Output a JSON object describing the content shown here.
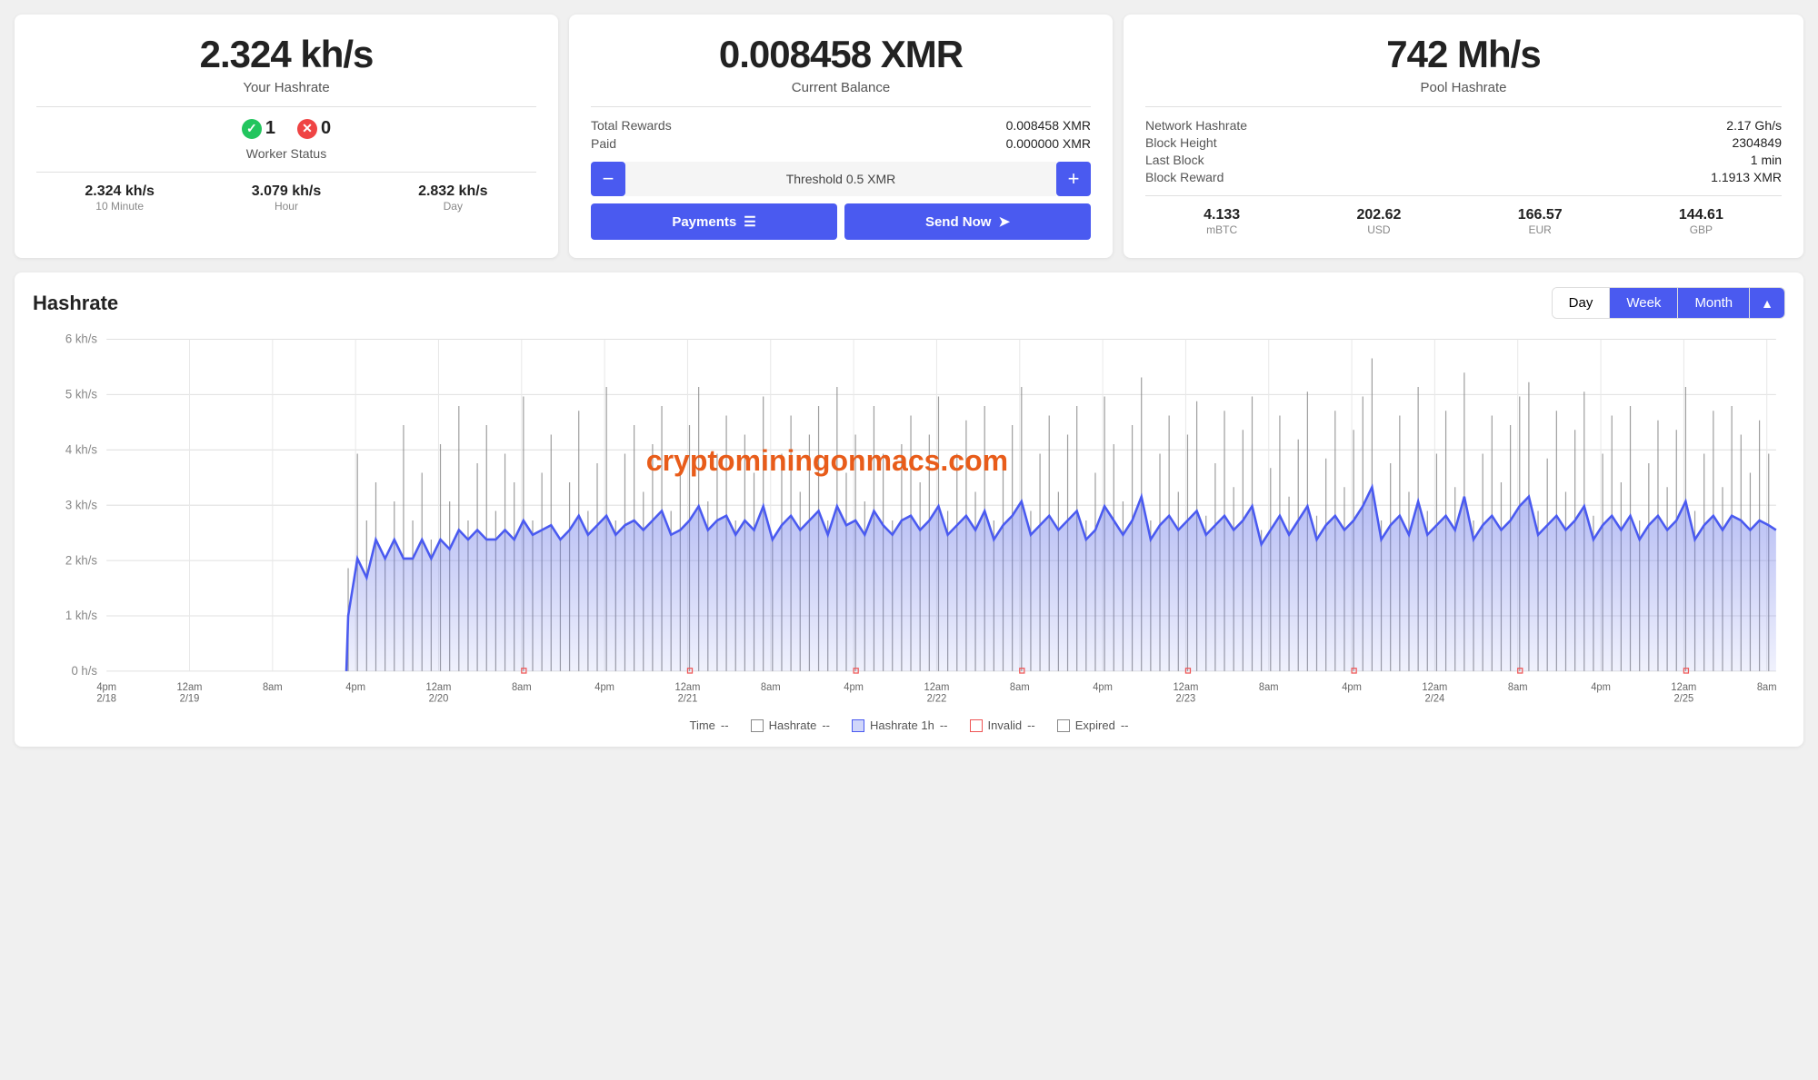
{
  "hashrate_panel": {
    "big_value": "2.324 kh/s",
    "label": "Your Hashrate",
    "worker_online": "1",
    "worker_offline": "0",
    "worker_label": "Worker Status",
    "stat_10min_val": "2.324 kh/s",
    "stat_10min_label": "10 Minute",
    "stat_hour_val": "3.079 kh/s",
    "stat_hour_label": "Hour",
    "stat_day_val": "2.832 kh/s",
    "stat_day_label": "Day"
  },
  "balance_panel": {
    "big_value": "0.008458 XMR",
    "label": "Current Balance",
    "total_rewards_label": "Total Rewards",
    "total_rewards_value": "0.008458 XMR",
    "paid_label": "Paid",
    "paid_value": "0.000000 XMR",
    "threshold_text": "Threshold 0.5 XMR",
    "btn_minus": "−",
    "btn_plus": "+",
    "payments_label": "Payments",
    "send_now_label": "Send Now"
  },
  "pool_panel": {
    "big_value": "742 Mh/s",
    "label": "Pool Hashrate",
    "network_hashrate_label": "Network Hashrate",
    "network_hashrate_value": "2.17 Gh/s",
    "block_height_label": "Block Height",
    "block_height_value": "2304849",
    "last_block_label": "Last Block",
    "last_block_value": "1 min",
    "block_reward_label": "Block Reward",
    "block_reward_value": "1.1913 XMR",
    "mbtc_val": "4.133",
    "mbtc_label": "mBTC",
    "usd_val": "202.62",
    "usd_label": "USD",
    "eur_val": "166.57",
    "eur_label": "EUR",
    "gbp_val": "144.61",
    "gbp_label": "GBP"
  },
  "chart": {
    "title": "Hashrate",
    "periods": [
      "Day",
      "Week",
      "Month"
    ],
    "active_period": "Month",
    "watermark": "cryptominingonmacs.com",
    "y_labels": [
      "6 kh/s",
      "5 kh/s",
      "4 kh/s",
      "3 kh/s",
      "2 kh/s",
      "1 kh/s",
      "0 h/s"
    ],
    "x_labels": [
      "4pm\n2/18",
      "12am\n2/19",
      "8am",
      "4pm",
      "12am\n2/20",
      "8am",
      "4pm",
      "12am\n2/21",
      "8am",
      "4pm",
      "12am\n2/22",
      "8am",
      "4pm",
      "12am\n2/23",
      "8am",
      "4pm",
      "12am\n2/24",
      "8am",
      "4pm",
      "12am\n2/25",
      "8am"
    ],
    "legend": {
      "time_label": "Time",
      "time_val": "--",
      "hashrate_label": "Hashrate",
      "hashrate_val": "--",
      "hashrate1h_label": "Hashrate 1h",
      "hashrate1h_val": "--",
      "invalid_label": "Invalid",
      "invalid_val": "--",
      "expired_label": "Expired",
      "expired_val": "--"
    }
  },
  "accent_color": "#4a5af0"
}
